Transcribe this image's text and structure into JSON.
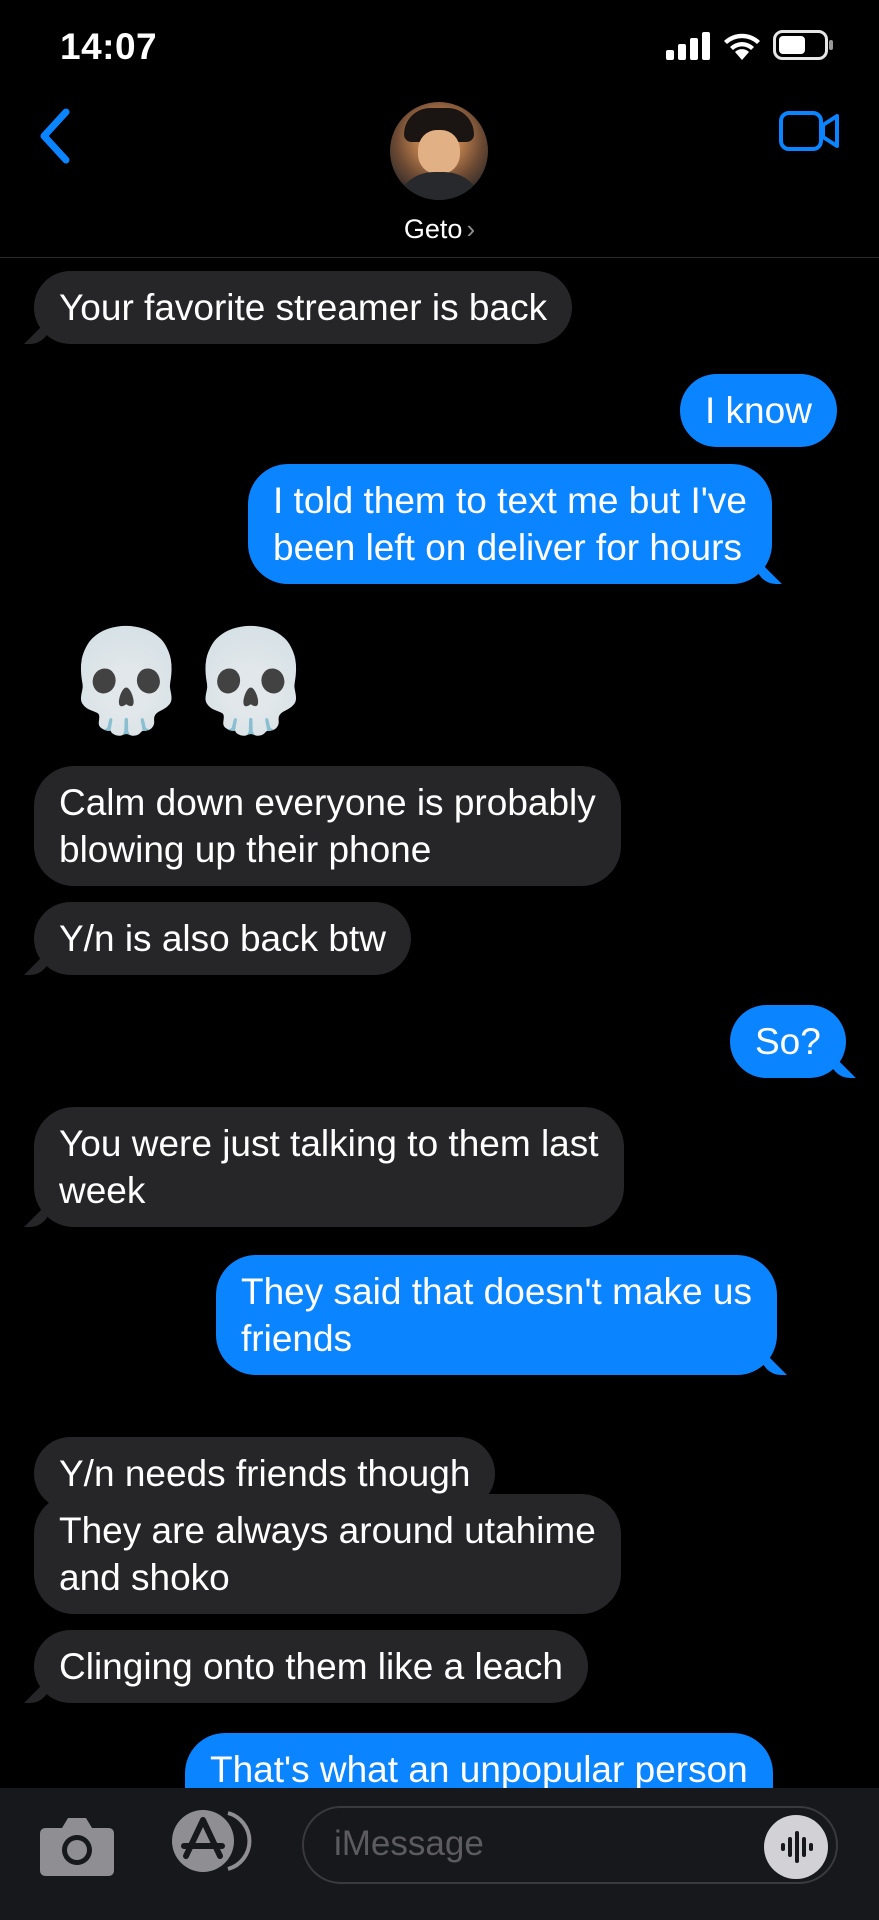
{
  "status_bar": {
    "time": "14:07"
  },
  "header": {
    "contact_name": "Geto"
  },
  "messages": [
    {
      "text": "Your favorite streamer is back",
      "from": "them"
    },
    {
      "text": "I know",
      "from": "me"
    },
    {
      "text": "I told them to text me but I've\nbeen left on deliver for hours",
      "from": "me"
    },
    {
      "text": "💀💀",
      "from": "them",
      "emoji": true
    },
    {
      "text": "Calm down everyone is probably\nblowing up their phone",
      "from": "them"
    },
    {
      "text": "Y/n is also back btw",
      "from": "them"
    },
    {
      "text": "So?",
      "from": "me"
    },
    {
      "text": "You were just talking to them last\nweek",
      "from": "them"
    },
    {
      "text": "They said that doesn't make us\nfriends",
      "from": "me"
    },
    {
      "text": "Y/n needs friends though",
      "from": "them"
    },
    {
      "text": "They are always around utahime\nand shoko",
      "from": "them"
    },
    {
      "text": "Clinging onto them like a leach",
      "from": "them"
    },
    {
      "text": "That's what an unpopular person",
      "from": "me"
    }
  ],
  "composer": {
    "placeholder": "iMessage"
  },
  "colors": {
    "sent_bubble": "#0a84ff",
    "received_bubble": "#262628",
    "accent": "#0a84ff"
  }
}
